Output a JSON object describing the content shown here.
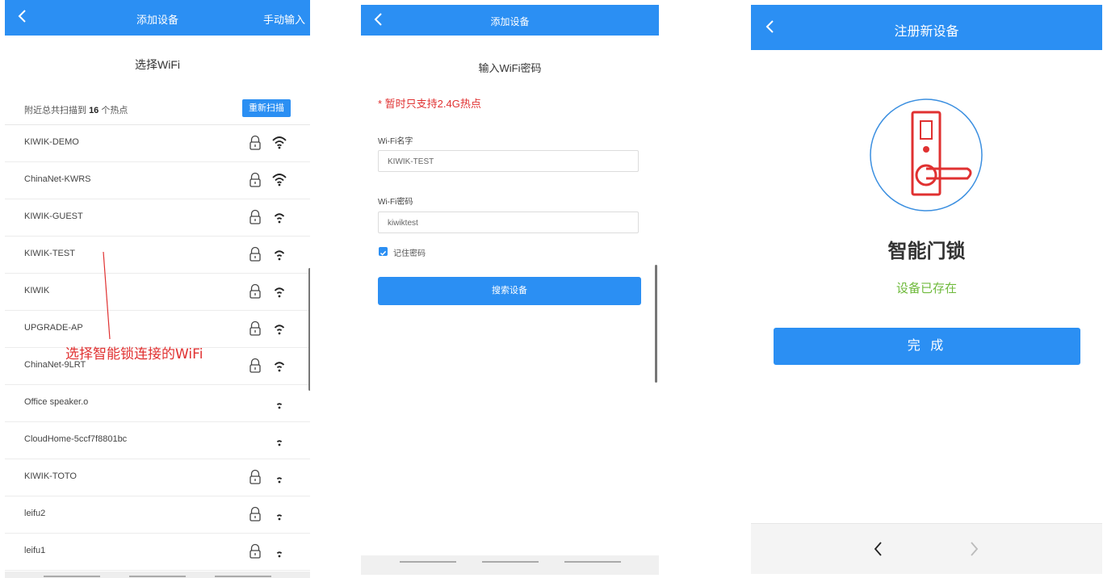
{
  "colors": {
    "accent": "#2b8ff3",
    "warning": "#e03131",
    "success": "#6fba3c"
  },
  "panel1": {
    "header": {
      "title": "添加设备",
      "right_action": "手动输入"
    },
    "subtitle": "选择WiFi",
    "scan": {
      "prefix": "附近总共扫描到",
      "count": "16",
      "suffix": "个热点",
      "rescan_label": "重新扫描"
    },
    "networks": [
      {
        "ssid": "KIWIK-DEMO",
        "locked": true,
        "signal": "strong"
      },
      {
        "ssid": "ChinaNet-KWRS",
        "locked": true,
        "signal": "strong"
      },
      {
        "ssid": "KIWIK-GUEST",
        "locked": true,
        "signal": "medium"
      },
      {
        "ssid": "KIWIK-TEST",
        "locked": true,
        "signal": "medium"
      },
      {
        "ssid": "KIWIK",
        "locked": true,
        "signal": "medium"
      },
      {
        "ssid": "UPGRADE-AP",
        "locked": true,
        "signal": "medium"
      },
      {
        "ssid": "ChinaNet-9LRT",
        "locked": true,
        "signal": "medium"
      },
      {
        "ssid": "Office speaker.o",
        "locked": false,
        "signal": "weak"
      },
      {
        "ssid": "CloudHome-5ccf7f8801bc",
        "locked": false,
        "signal": "weak"
      },
      {
        "ssid": "KIWIK-TOTO",
        "locked": true,
        "signal": "weak"
      },
      {
        "ssid": "leifu2",
        "locked": true,
        "signal": "weak"
      },
      {
        "ssid": "leifu1",
        "locked": true,
        "signal": "weak"
      }
    ],
    "annotation": "选择智能锁连接的WiFi"
  },
  "panel2": {
    "header": {
      "title": "添加设备"
    },
    "subtitle": "输入WiFi密码",
    "tip": "* 暂时只支持2.4G热点",
    "wifi_name_label": "Wi-Fi名字",
    "wifi_name_value": "KIWIK-TEST",
    "wifi_pwd_label": "Wi-Fi密码",
    "wifi_pwd_value": "kiwiktest",
    "remember_label": "记住密码",
    "remember_checked": true,
    "search_button": "搜索设备"
  },
  "panel3": {
    "header": {
      "title": "注册新设备"
    },
    "device_name": "智能门锁",
    "status": "设备已存在",
    "done_button": "完 成"
  }
}
